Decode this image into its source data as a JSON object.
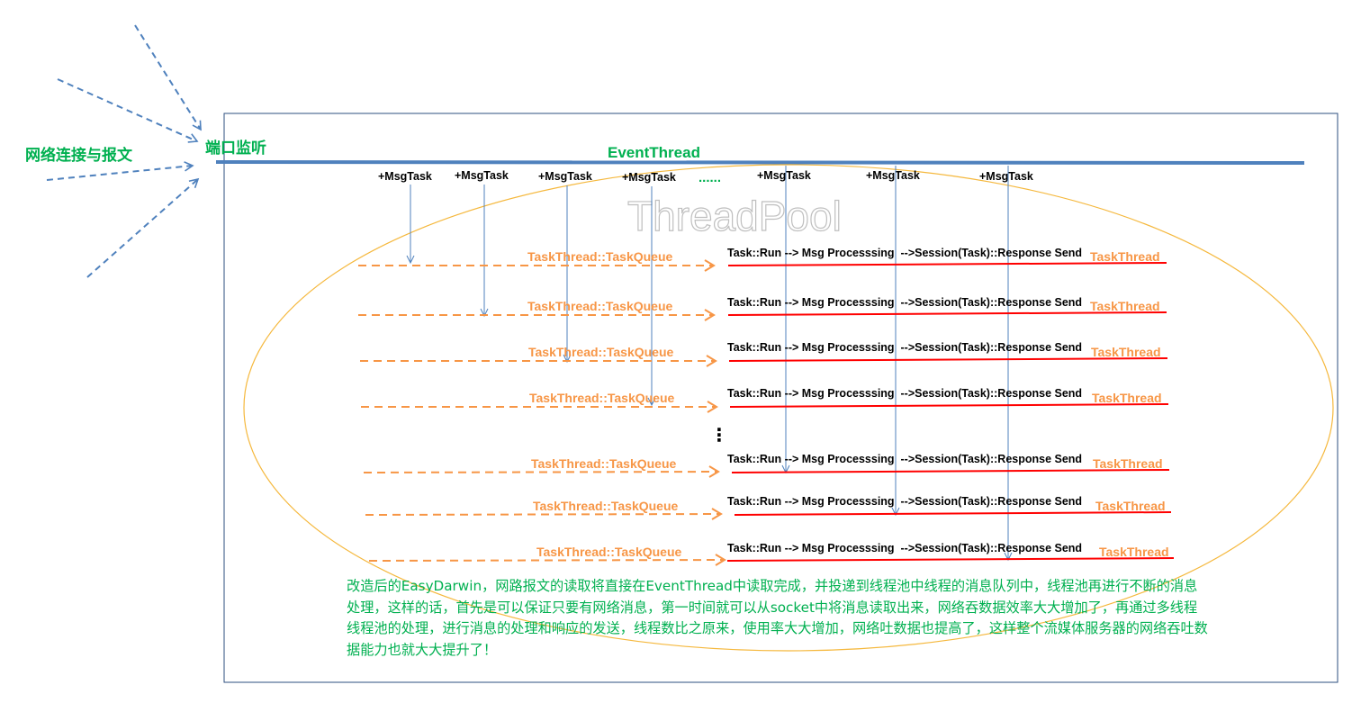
{
  "left_label": "网络连接与报文",
  "port_label": "端口监听",
  "event_thread": "EventThread",
  "watermark": "ThreadPool",
  "msgtasks": [
    "+MsgTask",
    "+MsgTask",
    "+MsgTask",
    "+MsgTask",
    "+MsgTask",
    "+MsgTask",
    "+MsgTask"
  ],
  "msgtask_ellipsis": "......",
  "vertical_ellipsis": "⋮",
  "rows": [
    {
      "queue": "TaskThread::TaskQueue",
      "run": "Task::Run --> Msg Processsing  -->Session(Task)::Response Send",
      "thread": "TaskThread"
    },
    {
      "queue": "TaskThread::TaskQueue",
      "run": "Task::Run --> Msg Processsing  -->Session(Task)::Response Send",
      "thread": "TaskThread"
    },
    {
      "queue": "TaskThread::TaskQueue",
      "run": "Task::Run --> Msg Processsing  -->Session(Task)::Response Send",
      "thread": "TaskThread"
    },
    {
      "queue": "TaskThread::TaskQueue",
      "run": "Task::Run --> Msg Processsing  -->Session(Task)::Response Send",
      "thread": "TaskThread"
    },
    {
      "queue": "TaskThread::TaskQueue",
      "run": "Task::Run --> Msg Processsing  -->Session(Task)::Response Send",
      "thread": "TaskThread"
    },
    {
      "queue": "TaskThread::TaskQueue",
      "run": "Task::Run --> Msg Processsing  -->Session(Task)::Response Send",
      "thread": "TaskThread"
    },
    {
      "queue": "TaskThread::TaskQueue",
      "run": "Task::Run --> Msg Processsing  -->Session(Task)::Response Send",
      "thread": "TaskThread"
    }
  ],
  "description": "改造后的EasyDarwin，网路报文的读取将直接在EventThread中读取完成，并投递到线程池中线程的消息队列中，线程池再进行不断的消息处理，这样的话，首先是可以保证只要有网络消息，第一时间就可以从socket中将消息读取出来，网络吞数据效率大大增加了，再通过多线程线程池的处理，进行消息的处理和响应的发送，线程数比之原来，使用率大大增加，网络吐数据也提高了，这样整个流媒体服务器的网络吞吐数据能力也就大大提升了！",
  "colors": {
    "blue": "#4f81bd",
    "green": "#00b050",
    "orange": "#f79646",
    "red": "#ff0000",
    "ellipse": "#f5b83d",
    "frame": "#2e4f7f"
  }
}
